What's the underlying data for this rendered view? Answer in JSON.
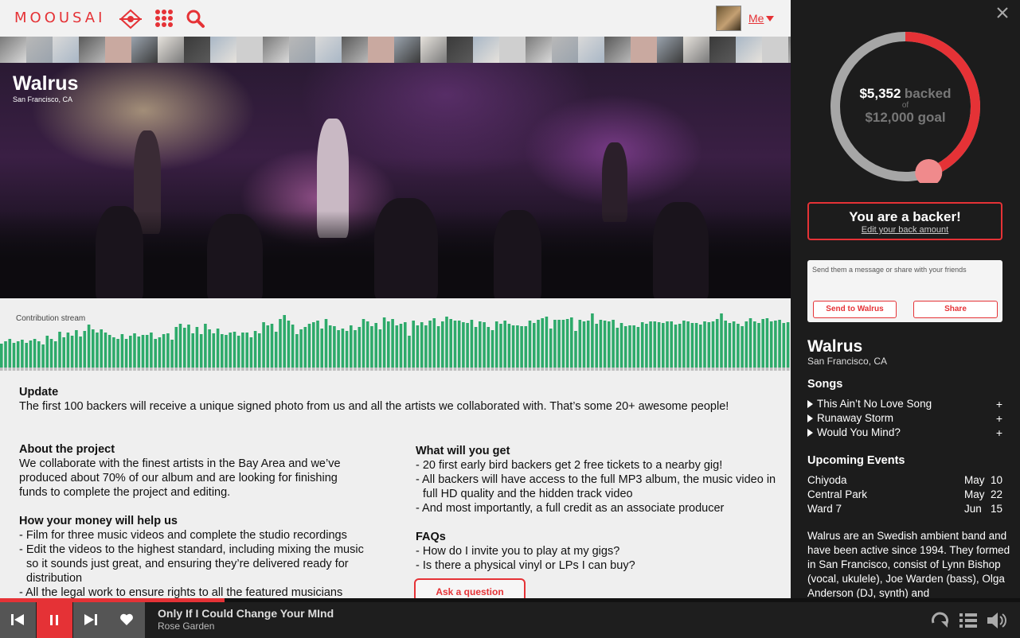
{
  "app": {
    "logo_text": "MOOUSAI"
  },
  "topbar": {
    "user_label": "Me"
  },
  "hero": {
    "band_name": "Walrus",
    "location": "San Francisco, CA"
  },
  "stream": {
    "label": "Contribution stream",
    "values": [
      30,
      33,
      36,
      31,
      33,
      35,
      31,
      34,
      36,
      33,
      29,
      40,
      36,
      33,
      45,
      38,
      44,
      40,
      47,
      39,
      46,
      54,
      48,
      44,
      48,
      44,
      41,
      38,
      36,
      42,
      36,
      40,
      43,
      39,
      41,
      41,
      44,
      36,
      38,
      42,
      43,
      35,
      51,
      55,
      50,
      54,
      43,
      51,
      42,
      55,
      48,
      43,
      49,
      42,
      41,
      44,
      45,
      40,
      44,
      44,
      38,
      46,
      43,
      57,
      53,
      55,
      45,
      61,
      66,
      59,
      54,
      42,
      48,
      51,
      55,
      57,
      59,
      49,
      61,
      53,
      52,
      47,
      49,
      46,
      53,
      47,
      51,
      61,
      58,
      52,
      56,
      48,
      63,
      58,
      61,
      53,
      55,
      57,
      40,
      59,
      53,
      57,
      53,
      59,
      62,
      52,
      58,
      64,
      61,
      59,
      59,
      57,
      56,
      60,
      51,
      58,
      57,
      51,
      47,
      58,
      55,
      59,
      55,
      53,
      53,
      52,
      52,
      59,
      56,
      60,
      62,
      64,
      49,
      60,
      60,
      60,
      61,
      63,
      46,
      60,
      58,
      59,
      68,
      55,
      60,
      59,
      58,
      60,
      50,
      56,
      52,
      53,
      53,
      51,
      57,
      55,
      58,
      58,
      57,
      56,
      58,
      58,
      54,
      55,
      59,
      58,
      56,
      56,
      54,
      58,
      57,
      58,
      61,
      68,
      59,
      56,
      58,
      55,
      52,
      58,
      62,
      58,
      56,
      61,
      62,
      58,
      59,
      60,
      56,
      57
    ],
    "bar_color": "#2daa6a"
  },
  "content": {
    "update_title": "Update",
    "update_text": "The first 100 backers will receive a unique signed photo from us and all the artists we collaborated with. That’s some 20+ awesome people!",
    "about_title": "About the project",
    "about_lines": [
      "We collaborate with the finest artists in the Bay Area and we’ve",
      "produced about 70% of our album and are looking for finishing",
      "funds to complete the project and editing."
    ],
    "money_title": "How your money will help us",
    "money_items": [
      "- Film for three music videos and complete the studio recordings",
      "- Edit the videos to the highest standard, including mixing the music so it sounds just great, and ensuring they’re delivered ready for distribution",
      "- All the legal work to ensure rights to all the featured musicians"
    ],
    "get_title": "What will you get",
    "get_items": [
      "- 20 first early bird backers get 2 free tickets to a nearby gig!",
      "- All backers will have access to the full MP3 album, the music video in full HD quality and the hidden track video",
      "- And most importantly, a full credit as an associate producer"
    ],
    "faq_title": "FAQs",
    "faq_items": [
      "- How do I invite you to play at my gigs?",
      "- Is there a physical vinyl or LPs I can buy?"
    ],
    "ask_button": "Ask a question"
  },
  "funding": {
    "amount": "$5,352",
    "backed_word": "backed",
    "of_word": "of",
    "goal": "$12,000 goal",
    "backed_value": 5352,
    "goal_value": 12000,
    "accent_color": "#e53236"
  },
  "backer": {
    "title": "You are a backer!",
    "edit_link": "Edit your back amount"
  },
  "message": {
    "placeholder": "Send them a message or share with your friends",
    "send_button": "Send to Walrus",
    "share_button": "Share"
  },
  "artist": {
    "name": "Walrus",
    "location": "San Francisco, CA"
  },
  "songs": {
    "title": "Songs",
    "items": [
      {
        "title": "This Ain’t No Love Song",
        "add": "+"
      },
      {
        "title": "Runaway Storm",
        "add": "+"
      },
      {
        "title": "Would You Mind?",
        "add": "+"
      }
    ]
  },
  "events": {
    "title": "Upcoming Events",
    "items": [
      {
        "venue": "Chiyoda",
        "date": "May  10"
      },
      {
        "venue": "Central Park",
        "date": "May  22"
      },
      {
        "venue": "Ward 7",
        "date": "Jun   15"
      }
    ]
  },
  "bio": "Walrus are an Swedish ambient band and have been active since 1994. They formed in San Francisco, consist of Lynn Bishop (vocal, ukulele), Joe Warden (bass), Olga Anderson (DJ, synth) and",
  "player": {
    "track_title": "Only If I Could Change Your MInd",
    "track_artist": "Rose Garden",
    "progress": 0.22
  }
}
